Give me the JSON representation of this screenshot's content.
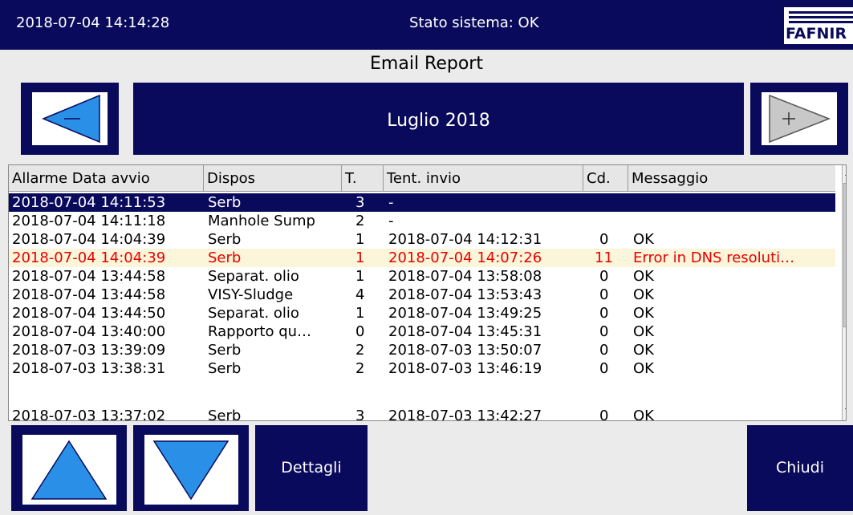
{
  "header": {
    "datetime": "2018-07-04  14:14:28",
    "status": "Stato sistema: OK",
    "logo_text": "FAFNIR"
  },
  "page": {
    "title": "Email Report",
    "month": "Luglio  2018"
  },
  "nav": {
    "prev_icon": "arrow-left-minus-icon",
    "next_icon": "arrow-right-plus-icon"
  },
  "table": {
    "columns": [
      "Allarme Data avvio",
      "Dispos",
      "T.",
      "Tent. invio",
      "Cd.",
      "Messaggio"
    ],
    "rows": [
      {
        "start": "2018-07-04 14:11:53",
        "device": "Serb",
        "t": "3",
        "sent": "-",
        "cd": "",
        "msg": ""
      },
      {
        "start": "2018-07-04 14:11:18",
        "device": "Manhole Sump",
        "t": "2",
        "sent": "-",
        "cd": "",
        "msg": ""
      },
      {
        "start": "2018-07-04 14:04:39",
        "device": "Serb",
        "t": "1",
        "sent": "2018-07-04 14:12:31",
        "cd": "0",
        "msg": "OK"
      },
      {
        "start": "2018-07-04 14:04:39",
        "device": "Serb",
        "t": "1",
        "sent": "2018-07-04 14:07:26",
        "cd": "11",
        "msg": "Error in DNS resoluti…"
      },
      {
        "start": "2018-07-04 13:44:58",
        "device": "Separat. olio",
        "t": "1",
        "sent": "2018-07-04 13:58:08",
        "cd": "0",
        "msg": "OK"
      },
      {
        "start": "2018-07-04 13:44:58",
        "device": "VISY-Sludge",
        "t": "4",
        "sent": "2018-07-04 13:53:43",
        "cd": "0",
        "msg": "OK"
      },
      {
        "start": "2018-07-04 13:44:50",
        "device": "Separat. olio",
        "t": "1",
        "sent": "2018-07-04 13:49:25",
        "cd": "0",
        "msg": "OK"
      },
      {
        "start": "2018-07-04 13:40:00",
        "device": "Rapporto qu…",
        "t": "0",
        "sent": "2018-07-04 13:45:31",
        "cd": "0",
        "msg": "OK"
      },
      {
        "start": "2018-07-03 13:39:09",
        "device": "Serb",
        "t": "2",
        "sent": "2018-07-03 13:50:07",
        "cd": "0",
        "msg": "OK"
      },
      {
        "start": "2018-07-03 13:38:31",
        "device": "Serb",
        "t": "2",
        "sent": "2018-07-03 13:46:19",
        "cd": "0",
        "msg": "OK"
      },
      {
        "start": "2018-07-03 13:37:02",
        "device": "Serb",
        "t": "3",
        "sent": "2018-07-03 13:42:27",
        "cd": "0",
        "msg": "OK"
      }
    ]
  },
  "buttons": {
    "details": "Dettagli",
    "close": "Chiudi",
    "up_icon": "arrow-up-icon",
    "down_icon": "arrow-down-icon"
  },
  "colors": {
    "primary": "#0a0a5c",
    "accent": "#2a8fe6",
    "error": "#e80000",
    "error_bg": "#fbf6d9"
  }
}
